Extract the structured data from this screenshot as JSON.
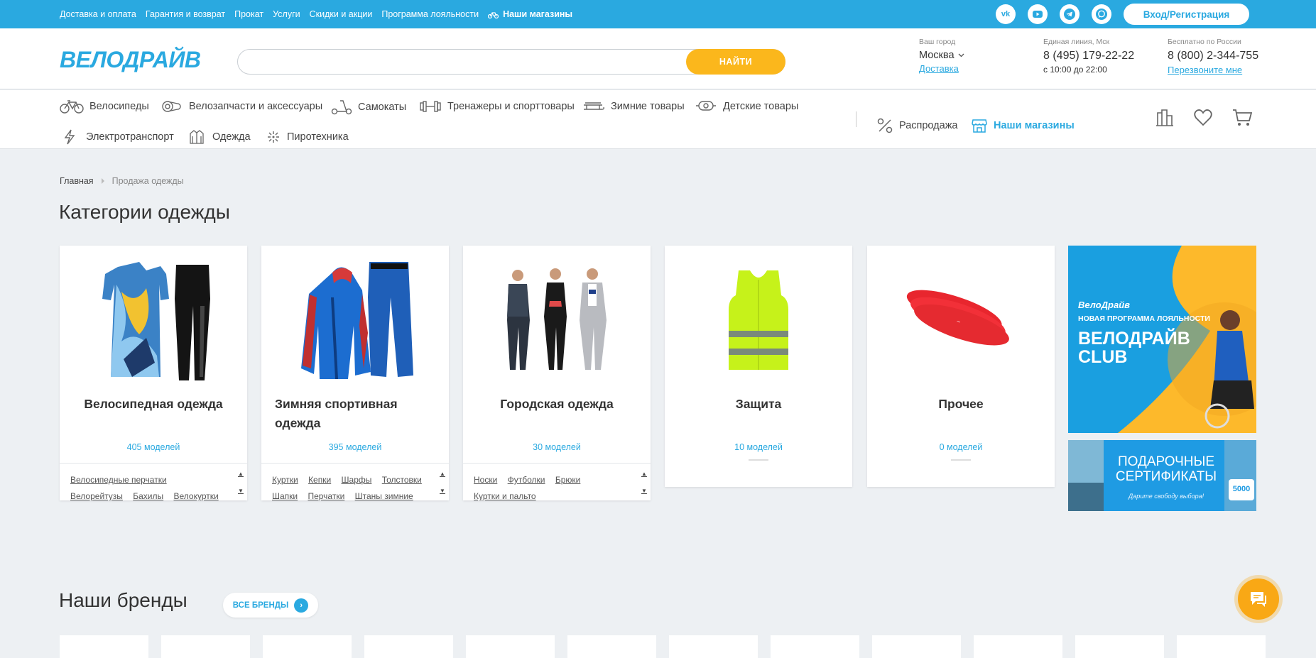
{
  "topbar": {
    "links": [
      "Доставка и оплата",
      "Гарантия и возврат",
      "Прокат",
      "Услуги",
      "Скидки и акции",
      "Программа лояльности"
    ],
    "stores_link": "Наши магазины",
    "login": "Вход/Регистрация",
    "social_icons": [
      "vk-icon",
      "youtube-icon",
      "telegram-icon",
      "chat-bubble-icon"
    ]
  },
  "header": {
    "logo": "ВЕЛОДРАЙВ",
    "search": {
      "value": "",
      "placeholder": "",
      "button": "НАЙТИ"
    },
    "city": {
      "label": "Ваш город",
      "value": "Москва",
      "link": "Доставка"
    },
    "hotline": {
      "label": "Единая линия, Мск",
      "phone": "8 (495) 179-22-22",
      "hours": "с 10:00 до 22:00"
    },
    "free": {
      "label": "Бесплатно по России",
      "phone": "8 (800) 2-344-755",
      "link": "Перезвоните мне"
    }
  },
  "nav": {
    "items": [
      "Велосипеды",
      "Велозапчасти и аксессуары",
      "Самокаты",
      "Тренажеры и спорттовары",
      "Зимние товары",
      "Детские товары",
      "Электротранспорт",
      "Одежда",
      "Пиротехника"
    ],
    "sale": "Распродажа",
    "stores": "Наши магазины"
  },
  "breadcrumb": {
    "home": "Главная",
    "current": "Продажа одежды"
  },
  "page_title": "Категории одежды",
  "categories": [
    {
      "title": "Велосипедная одежда",
      "count": "405 моделей",
      "subs": [
        "Велосипедные перчатки",
        "Велорейтузы",
        "Бахилы",
        "Велокуртки"
      ]
    },
    {
      "title": "Зимняя спортивная одежда",
      "count": "395 моделей",
      "subs": [
        "Куртки",
        "Кепки",
        "Шарфы",
        "Толстовки",
        "Шапки",
        "Перчатки",
        "Штаны зимние"
      ]
    },
    {
      "title": "Городская одежда",
      "count": "30 моделей",
      "subs": [
        "Носки",
        "Футболки",
        "Брюки",
        "Куртки и пальто"
      ]
    },
    {
      "title": "Защита",
      "count": "10 моделей"
    },
    {
      "title": "Прочее",
      "count": "0 моделей"
    }
  ],
  "promo1": {
    "brand": "ВелоДрайв",
    "subtitle": "НОВАЯ ПРОГРАММА ЛОЯЛЬНОСТИ",
    "line1": "ВЕЛОДРАЙВ",
    "line2": "CLUB"
  },
  "promo2": {
    "line1": "ПОДАРОЧНЫЕ",
    "line2": "СЕРТИФИКАТЫ",
    "tagline": "Дарите свободу выбора!",
    "amount": "5000"
  },
  "brands": {
    "title": "Наши бренды",
    "all": "ВСЕ БРЕНДЫ"
  },
  "colors": {
    "accent": "#2aa9e0",
    "button": "#fbb71c",
    "chat": "#f9a815"
  }
}
